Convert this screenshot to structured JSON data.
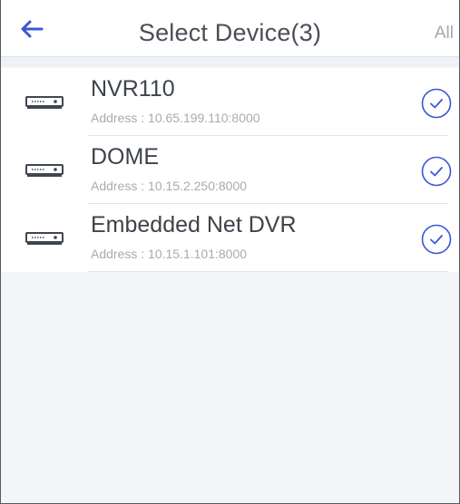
{
  "header": {
    "title": "Select Device(3)",
    "all_label": "All"
  },
  "devices": [
    {
      "name": "NVR110",
      "address": "Address : 10.65.199.110:8000",
      "selected": true
    },
    {
      "name": "DOME",
      "address": "Address : 10.15.2.250:8000",
      "selected": true
    },
    {
      "name": "Embedded Net DVR",
      "address": "Address : 10.15.1.101:8000",
      "selected": true
    }
  ],
  "icons": {
    "back": "arrow-left-icon",
    "device": "dvr-device-icon",
    "check": "check-circle-icon"
  },
  "colors": {
    "accent": "#3b57d6",
    "title_text": "#4a4f57",
    "muted_text": "#a7abb0"
  }
}
